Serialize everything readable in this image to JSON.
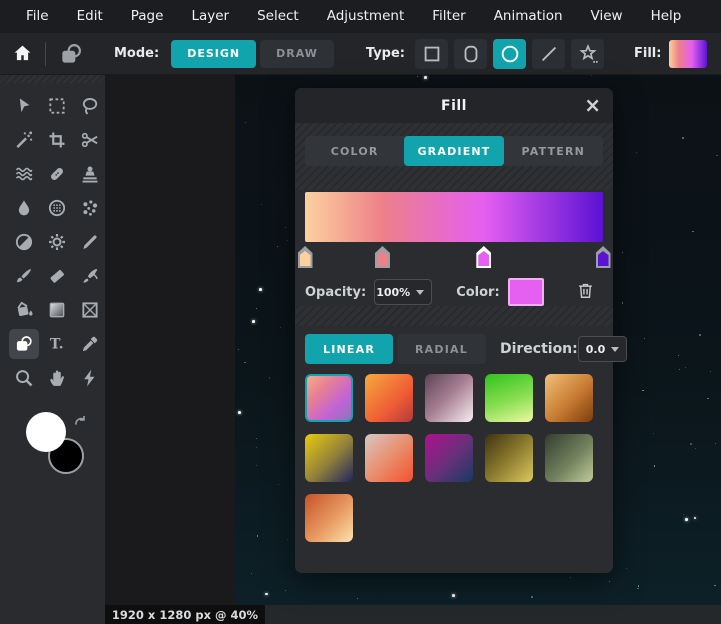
{
  "menu": {
    "items": [
      "File",
      "Edit",
      "Page",
      "Layer",
      "Select",
      "Adjustment",
      "Filter",
      "Animation",
      "View",
      "Help"
    ]
  },
  "options_bar": {
    "mode_label": "Mode:",
    "mode_options": [
      "DESIGN",
      "DRAW"
    ],
    "mode_selected": "DESIGN",
    "type_label": "Type:",
    "type_options": [
      "rectangle",
      "rounded-rectangle",
      "ellipse",
      "line",
      "star"
    ],
    "type_selected": "ellipse",
    "fill_label": "Fill:"
  },
  "toolbar_left": {
    "tools": [
      "move-tool",
      "marquee-select-tool",
      "lasso-tool",
      "wand-tool",
      "crop-tool",
      "cutout-tool",
      "liquify-tool",
      "heal-tool",
      "clone-stamp-tool",
      "blur-tool",
      "pixelate-tool",
      "disperse-tool",
      "dodge-burn-tool",
      "adjust-tool",
      "pen-tool",
      "brush-tool",
      "eraser-tool",
      "smudge-tool",
      "fill-tool",
      "gradient-tool",
      "frame-tool",
      "shape-tool",
      "text-tool",
      "eyedropper-tool",
      "zoom-tool",
      "hand-tool",
      "quick-actions-tool"
    ],
    "selected": "shape-tool",
    "foreground_color": "#ffffff",
    "background_color": "#000000"
  },
  "fill_dialog": {
    "title": "Fill",
    "tabs": [
      "COLOR",
      "GRADIENT",
      "PATTERN"
    ],
    "active_tab": "GRADIENT",
    "gradient": {
      "stops": [
        {
          "color": "#fcd19f",
          "pos": 0
        },
        {
          "color": "#ed8089",
          "pos": 26
        },
        {
          "color": "#e55ff0",
          "pos": 60
        },
        {
          "color": "#5b12d3",
          "pos": 100
        }
      ],
      "selected_stop": 2
    },
    "opacity_label": "Opacity:",
    "opacity_value": "100%",
    "color_label": "Color:",
    "color_value": "#e55ff0",
    "style_options": [
      "LINEAR",
      "RADIAL"
    ],
    "style_selected": "LINEAR",
    "direction_label": "Direction:",
    "direction_value": "0.0",
    "selected_preset": 0,
    "presets": [
      {
        "angle": 135,
        "stops": [
          "#f3ae8b 0%",
          "#e87f95 32%",
          "#c163d8 68%",
          "#8a77b8 100%"
        ]
      },
      {
        "angle": 135,
        "stops": [
          "#f6a93e 0%",
          "#ef5b35 62%",
          "#b23a3c 100%"
        ]
      },
      {
        "angle": 135,
        "stops": [
          "#5c4358 0%",
          "#a87f92 48%",
          "#f7eef0 100%"
        ]
      },
      {
        "angle": 160,
        "stops": [
          "#2fc31d 0%",
          "#8ade52 55%",
          "#eef7a5 100%"
        ]
      },
      {
        "angle": 135,
        "stops": [
          "#f2c078 0%",
          "#c87b32 55%",
          "#7c3c0e 100%"
        ]
      },
      {
        "angle": 135,
        "stops": [
          "#e8cb0e 0%",
          "#96833a 52%",
          "#20265e 100%"
        ]
      },
      {
        "angle": 135,
        "stops": [
          "#d8c6c4 0%",
          "#e98a68 55%",
          "#f4502e 100%"
        ]
      },
      {
        "angle": 135,
        "stops": [
          "#b01090 0%",
          "#643179 55%",
          "#173a62 100%"
        ]
      },
      {
        "angle": 135,
        "stops": [
          "#3e3310 0%",
          "#8a7a2e 50%",
          "#dcc95e 100%"
        ]
      },
      {
        "angle": 135,
        "stops": [
          "#333d30 0%",
          "#71805c 55%",
          "#c2cb9c 100%"
        ]
      },
      {
        "angle": 135,
        "stops": [
          "#c65228 0%",
          "#e89a62 55%",
          "#fbe3ae 100%"
        ]
      }
    ]
  },
  "status_bar": {
    "text": "1920 x 1280 px @ 40%"
  },
  "colors": {
    "accent": "#12a4ac",
    "canvas_dark": "#0b151a"
  }
}
